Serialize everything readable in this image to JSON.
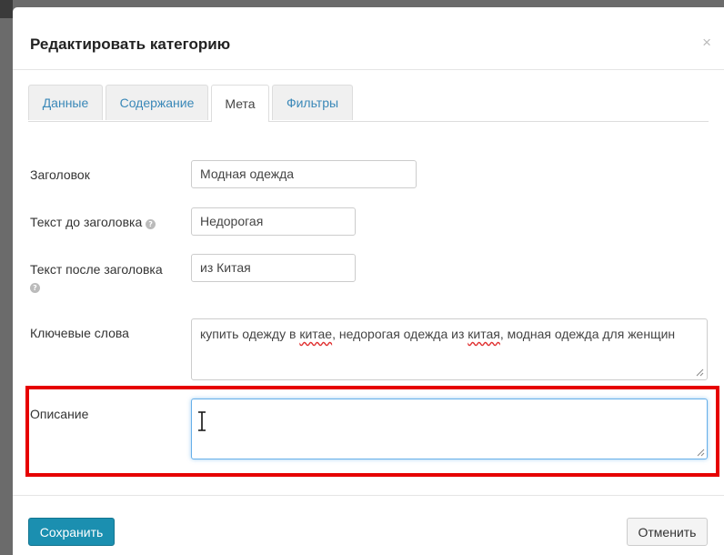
{
  "modal": {
    "title": "Редактировать категорию",
    "close_icon": "×"
  },
  "tabs": [
    {
      "label": "Данные",
      "active": false
    },
    {
      "label": "Содержание",
      "active": false
    },
    {
      "label": "Мета",
      "active": true
    },
    {
      "label": "Фильтры",
      "active": false
    }
  ],
  "form": {
    "title_label": "Заголовок",
    "title_value": "Модная одежда",
    "before_label": "Текст до заголовка",
    "before_value": "Недорогая",
    "after_label": "Текст после заголовка",
    "after_value": "из Китая",
    "keywords_label": "Ключевые слова",
    "keywords_value": {
      "part1": "купить одежду в ",
      "word1": "китае",
      "part2": ", недорогая одежда из ",
      "word2": "китая",
      "part3": ", модная одежда для женщин"
    },
    "description_label": "Описание",
    "description_value": ""
  },
  "footer": {
    "save_label": "Сохранить",
    "cancel_label": "Отменить"
  },
  "colors": {
    "accent": "#1b8fb0",
    "highlight": "#e60000",
    "tab_link": "#3a88b8"
  },
  "icons": {
    "help": "question-circle-icon",
    "close": "close-icon",
    "resize": "resize-grip-icon",
    "caret": "text-cursor-icon"
  }
}
